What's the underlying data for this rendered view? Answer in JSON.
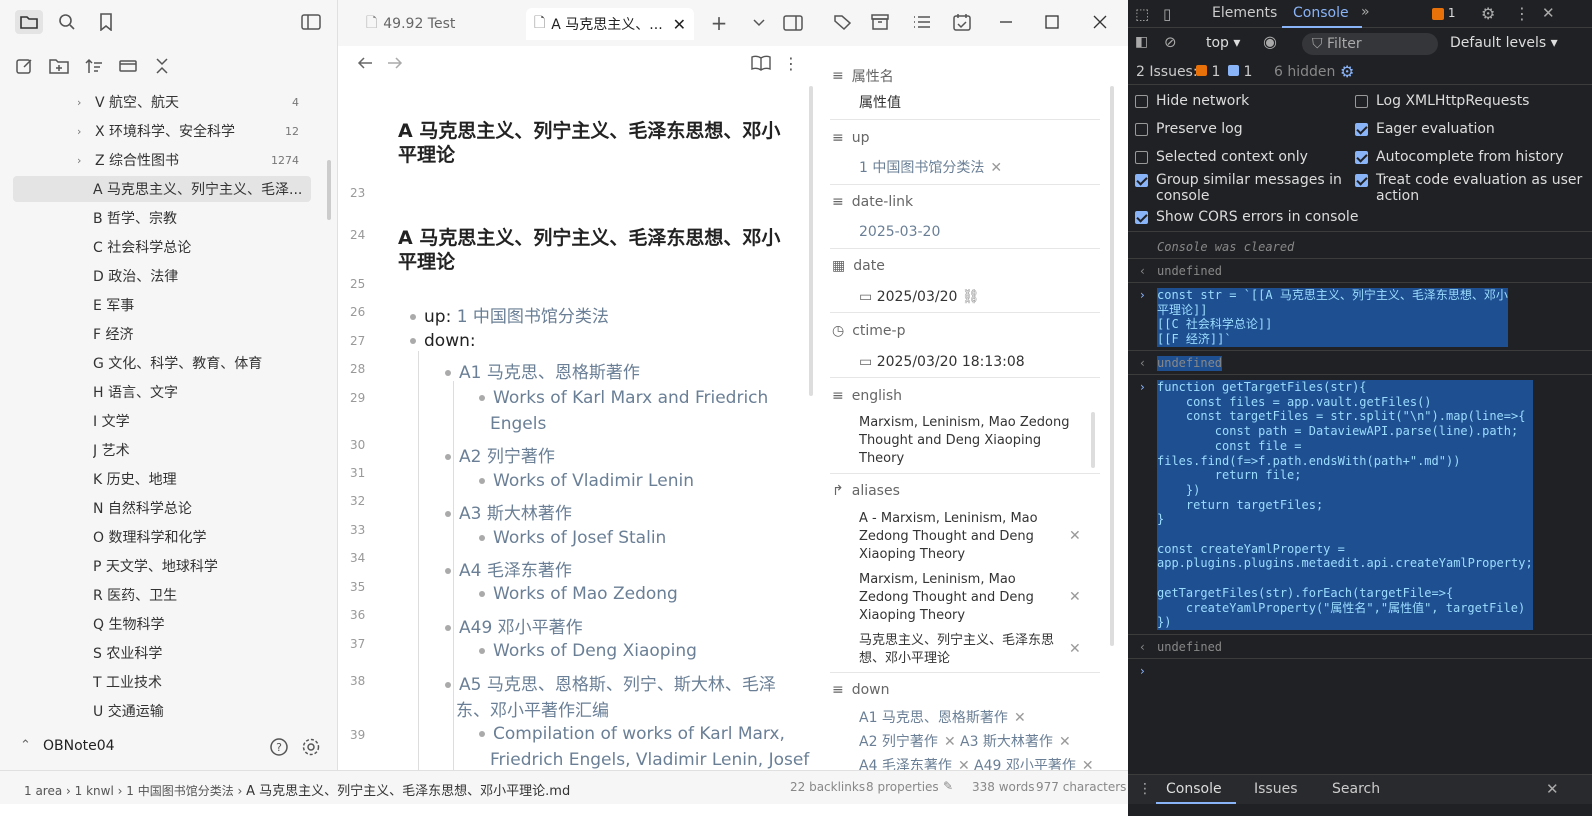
{
  "sidebar": {
    "tree": [
      {
        "label": "V 航空、航天",
        "count": "4",
        "type": "folder"
      },
      {
        "label": "X 环境科学、安全科学",
        "count": "12",
        "type": "folder"
      },
      {
        "label": "Z 综合性图书",
        "count": "1274",
        "type": "folder"
      },
      {
        "label": "A 马克思主义、列宁主义、毛泽...",
        "count": "",
        "type": "leaf",
        "selected": true
      },
      {
        "label": "B 哲学、宗教",
        "type": "leaf"
      },
      {
        "label": "C 社会科学总论",
        "type": "leaf"
      },
      {
        "label": "D 政治、法律",
        "type": "leaf"
      },
      {
        "label": "E 军事",
        "type": "leaf"
      },
      {
        "label": "F 经济",
        "type": "leaf"
      },
      {
        "label": "G 文化、科学、教育、体育",
        "type": "leaf"
      },
      {
        "label": "H 语言、文字",
        "type": "leaf"
      },
      {
        "label": "I 文学",
        "type": "leaf"
      },
      {
        "label": "J 艺术",
        "type": "leaf"
      },
      {
        "label": "K 历史、地理",
        "type": "leaf"
      },
      {
        "label": "N 自然科学总论",
        "type": "leaf"
      },
      {
        "label": "O 数理科学和化学",
        "type": "leaf"
      },
      {
        "label": "P 天文学、地球科学",
        "type": "leaf"
      },
      {
        "label": "R 医药、卫生",
        "type": "leaf"
      },
      {
        "label": "Q 生物科学",
        "type": "leaf"
      },
      {
        "label": "S 农业科学",
        "type": "leaf"
      },
      {
        "label": "T 工业技术",
        "type": "leaf"
      },
      {
        "label": "U 交通运输",
        "type": "leaf"
      }
    ],
    "vault_name": "OBNote04"
  },
  "tabs": {
    "tab1": "49.92 Test",
    "tab2": "A 马克思主义、..."
  },
  "editor": {
    "title": "A 马克思主义、列宁主义、毛泽东思想、邓小平理论",
    "heading": "A 马克思主义、列宁主义、毛泽东思想、邓小平理论",
    "gutter": [
      "23",
      "24",
      "25",
      "26",
      "27",
      "28",
      "29",
      "30",
      "31",
      "32",
      "33",
      "34",
      "35",
      "36",
      "37",
      "38",
      "39"
    ],
    "up_label": "up:",
    "up_link": "1 中国图书馆分类法",
    "down_label": "down:",
    "items": [
      "A1 马克思、恩格斯著作",
      "Works of Karl Marx and Friedrich",
      "Engels",
      "A2 列宁著作",
      "Works of Vladimir Lenin",
      "A3 斯大林著作",
      "Works of Josef Stalin",
      "A4 毛泽东著作",
      "Works of Mao Zedong",
      "A49 邓小平著作",
      "Works of Deng Xiaoping",
      "A5 马克思、恩格斯、列宁、斯大林、毛泽",
      "东、邓小平著作汇编",
      "Compilation of works of Karl Marx,",
      "Friedrich Engels, Vladimir Lenin, Josef"
    ]
  },
  "properties": {
    "p1_key": "属性名",
    "p1_val": "属性值",
    "up_key": "up",
    "up_val": "1 中国图书馆分类法",
    "datelink_key": "date-link",
    "datelink_val": "2025-03-20",
    "date_key": "date",
    "date_val": "2025/03/20",
    "ctime_key": "ctime-p",
    "ctime_val": "2025/03/20 18:13:08",
    "english_key": "english",
    "english_val": "Marxism, Leninism, Mao Zedong Thought and Deng Xiaoping Theory",
    "aliases_key": "aliases",
    "alias1": "A - Marxism, Leninism, Mao Zedong Thought and Deng Xiaoping Theory",
    "alias2": "Marxism, Leninism, Mao Zedong Thought and Deng Xiaoping Theory",
    "alias3": "马克思主义、列宁主义、毛泽东思想、邓小平理论",
    "down_key": "down",
    "down_vals": [
      "A1 马克思、恩格斯著作",
      "A2 列宁著作",
      "A3 斯大林著作",
      "A4 毛泽东著作",
      "A49 邓小平著作"
    ]
  },
  "status": {
    "crumb1": "1 area",
    "crumb2": "1 knwl",
    "crumb3": "1 中国图书馆分类法",
    "crumb4": "A 马克思主义、列宁主义、毛泽东思想、邓小平理论.md",
    "backlinks": "22 backlinks",
    "props": "8 properties",
    "words": "338 words",
    "chars": "977 characters"
  },
  "devtools": {
    "tab_elements": "Elements",
    "tab_console": "Console",
    "warn_count": "1",
    "context": "top",
    "filter_placeholder": "Filter",
    "levels": "Default levels",
    "issues_label": "2 Issues:",
    "issues_warn": "1",
    "issues_info": "1",
    "hidden": "6 hidden",
    "opts": {
      "hide_network": "Hide network",
      "log_xhr": "Log XMLHttpRequests",
      "preserve_log": "Preserve log",
      "eager_eval": "Eager evaluation",
      "selected_ctx": "Selected context only",
      "autocomplete": "Autocomplete from history",
      "group_similar": "Group similar messages in console",
      "treat_code": "Treat code evaluation as user action",
      "cors": "Show CORS errors in console"
    },
    "cleared": "Console was cleared",
    "undefined": "undefined",
    "code1": "const str = `[[A 马克思主义、列宁主义、毛泽东思想、邓小\n平理论]]\n[[C 社会科学总论]]\n[[F 经济]]`",
    "code2": "function getTargetFiles(str){\n    const files = app.vault.getFiles()\n    const targetFiles = str.split(\"\\n\").map(line=>{\n        const path = DataviewAPI.parse(line).path;\n        const file =\nfiles.find(f=>f.path.endsWith(path+\".md\"))\n        return file;\n    })\n    return targetFiles;\n}\n\nconst createYamlProperty =\napp.plugins.plugins.metaedit.api.createYamlProperty;\n\ngetTargetFiles(str).forEach(targetFile=>{\n    createYamlProperty(\"属性名\",\"属性值\", targetFile)\n})",
    "bottom_console": "Console",
    "bottom_issues": "Issues",
    "bottom_search": "Search"
  }
}
